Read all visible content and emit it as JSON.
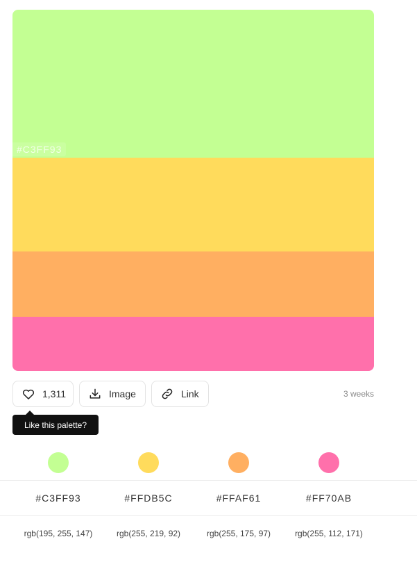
{
  "palette": {
    "colors": [
      {
        "hex": "#C3FF93",
        "color": "#C3FF93",
        "rgb": "rgb(195, 255, 147)"
      },
      {
        "hex": "#FFDB5C",
        "color": "#FFDB5C",
        "rgb": "rgb(255, 219, 92)"
      },
      {
        "hex": "#FFAF61",
        "color": "#FFAF61",
        "rgb": "rgb(255, 175, 97)"
      },
      {
        "hex": "#FF70AB",
        "color": "#FF70AB",
        "rgb": "rgb(255, 112, 171)"
      }
    ],
    "hover_hex_label": "#C3FF93"
  },
  "actions": {
    "like_count": "1,311",
    "image_label": "Image",
    "link_label": "Link",
    "time_ago": "3 weeks"
  },
  "tooltip": {
    "text": "Like this palette?"
  },
  "icons": {
    "like": "heart-icon",
    "image": "download-icon",
    "link": "link-icon"
  }
}
